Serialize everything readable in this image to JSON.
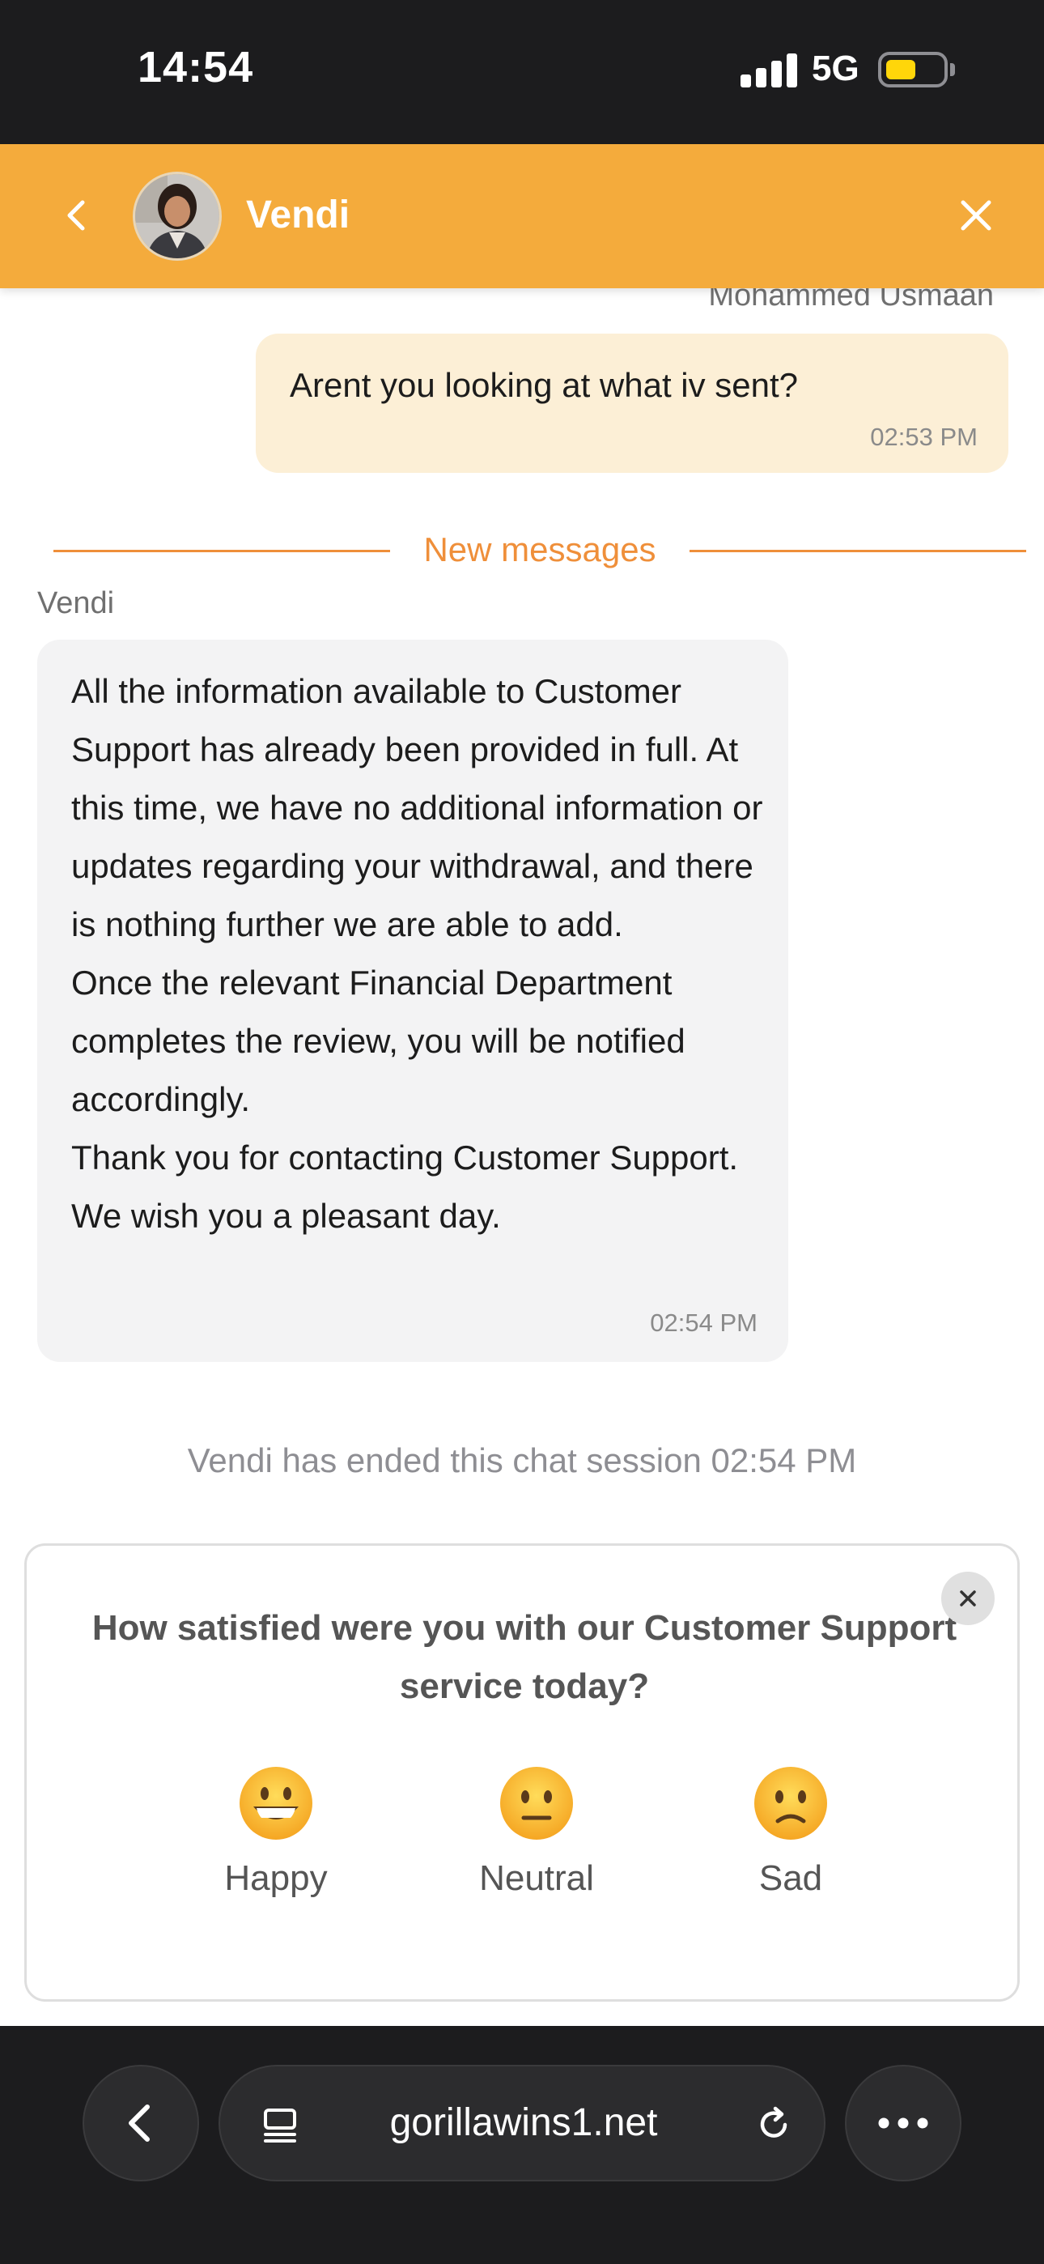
{
  "status_bar": {
    "time": "14:54",
    "network": "5G"
  },
  "header": {
    "agent_name": "Vendi"
  },
  "messages": {
    "user": {
      "sender": "Mohammed Usmaan",
      "text": "Arent you looking at what iv sent?",
      "time": "02:53 PM"
    },
    "divider_label": "New messages",
    "agent": {
      "sender": "Vendi",
      "paragraphs": [
        "All the information available to Customer Support has already been provided in full. At this time, we have no additional information or updates regarding your withdrawal, and there is nothing further we are able to add.",
        "Once the relevant Financial Department completes the review, you will be notified accordingly.",
        "Thank you for contacting Customer Support. We wish you a pleasant day."
      ],
      "time": "02:54 PM"
    },
    "session_ended": "Vendi has ended this chat session 02:54 PM"
  },
  "survey": {
    "question": "How satisfied were you with our Customer Support service today?",
    "options": [
      {
        "label": "Happy",
        "icon": "grinning-face-icon"
      },
      {
        "label": "Neutral",
        "icon": "neutral-face-icon"
      },
      {
        "label": "Sad",
        "icon": "slightly-frowning-face-icon"
      }
    ]
  },
  "browser": {
    "url": "gorillawins1.net"
  },
  "colors": {
    "header": "#f4ab3c",
    "accent": "#ef8f3a",
    "user_bubble": "#fcefd6",
    "agent_bubble": "#f3f3f4"
  }
}
